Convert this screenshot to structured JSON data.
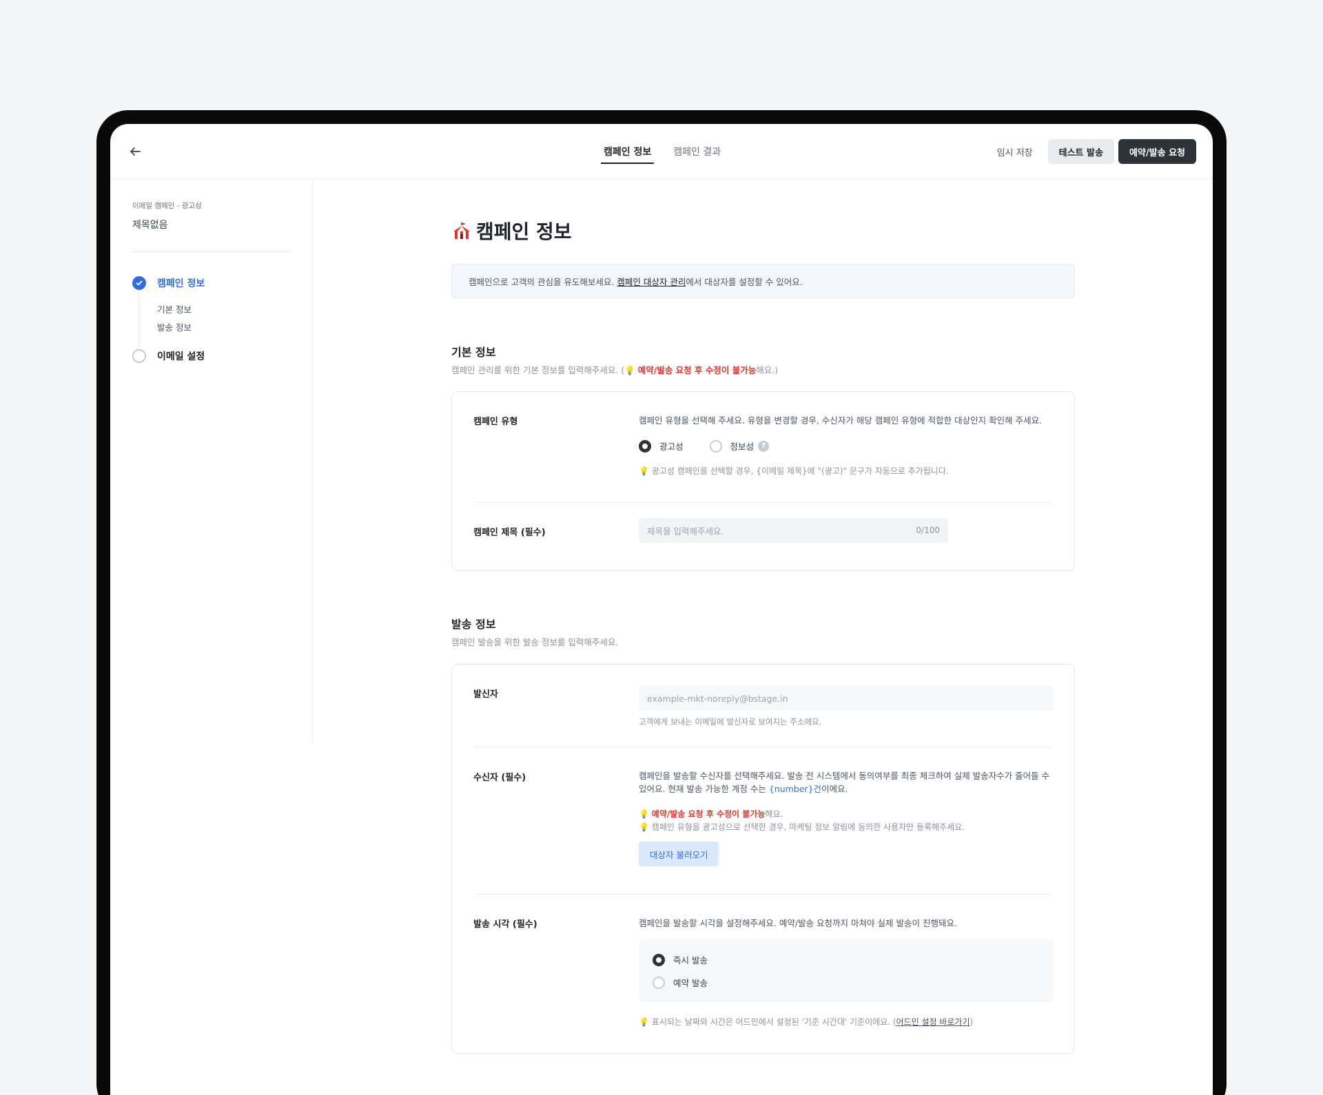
{
  "header": {
    "tabs": [
      {
        "label": "캠페인 정보",
        "active": true
      },
      {
        "label": "캠페인 결과",
        "active": false
      }
    ],
    "draft_save": "임시 저장",
    "test_send": "테스트 발송",
    "reserve_send": "예약/발송 요청"
  },
  "sidebar": {
    "crumb": "이메일 캠페인 - 광고성",
    "title": "제목없음",
    "steps": [
      {
        "label": "캠페인 정보",
        "status": "done"
      },
      {
        "label": "이메일 설정",
        "status": "todo"
      }
    ],
    "substeps": [
      "기본 정보",
      "발송 정보"
    ]
  },
  "main": {
    "title": "캠페인 정보",
    "notice": {
      "before": "캠페인으로 고객의 관심을 유도해보세요. ",
      "link": "캠페인 대상자 관리",
      "after": "에서 대상자를 설정할 수 있어요."
    },
    "basic": {
      "title": "기본 정보",
      "desc_before": "캠페인 관리를 위한 기본 정보를 입력해주세요. (",
      "desc_red": "예약/발송 요청 후 수정이 불가능",
      "desc_after": "해요.)",
      "type_label": "캠페인 유형",
      "type_desc": "캠페인 유형을 선택해 주세요. 유형을 변경할 경우, 수신자가 해당 캠페인 유형에 적합한 대상인지 확인해 주세요.",
      "type_options": [
        "광고성",
        "정보성"
      ],
      "type_selected": "광고성",
      "type_hint": "광고성 캠페인을 선택할 경우, {이메일 제목}에 \"(광고)\" 문구가 자동으로 추가됩니다.",
      "title_label": "캠페인 제목 (필수)",
      "title_placeholder": "제목을 입력해주세요.",
      "title_counter": "0/100"
    },
    "send": {
      "title": "발송 정보",
      "desc": "캠페인 발송을 위한 발송 정보를 입력해주세요.",
      "sender_label": "발신자",
      "sender_placeholder": "example-mkt-noreply@bstage.in",
      "sender_hint": "고객에게 보내는 이메일에 발신자로 보여지는 주소에요.",
      "recipient_label": "수신자 (필수)",
      "recipient_desc_before": "캠페인을 발송할 수신자를 선택해주세요. 발송 전 시스템에서 동의여부를 최종 체크하여 실제 발송자수가 줄어들 수 있어요. 현재 발송 가능한 계정 수는 ",
      "recipient_desc_blue": "{number}건",
      "recipient_desc_after": "이에요.",
      "recipient_hint1_red": "예약/발송 요청 후 수정이 불가능",
      "recipient_hint1_after": "해요.",
      "recipient_hint2": "캠페인 유형을 광고성으로 선택한 경우, 마케팅 정보 알림에 동의한 사용자만 등록해주세요.",
      "load_button": "대상자 불러오기",
      "time_label": "발송 시각 (필수)",
      "time_desc": "캠페인을 발송할 시각을 설정해주세요. 예약/발송 요청까지 마쳐야 실제 발송이 진행돼요.",
      "time_options": [
        "즉시 발송",
        "예약 발송"
      ],
      "time_selected": "즉시 발송",
      "time_hint_before": "표시되는 날짜와 시간은 어드민에서 설정된 '기준 시간대' 기준이에요. (",
      "time_hint_link": "어드민 설정 바로가기",
      "time_hint_after": ")"
    }
  },
  "colors": {
    "accent": "#2f6fe4",
    "dark_button": "#2e3338",
    "warning": "#e5332a"
  }
}
